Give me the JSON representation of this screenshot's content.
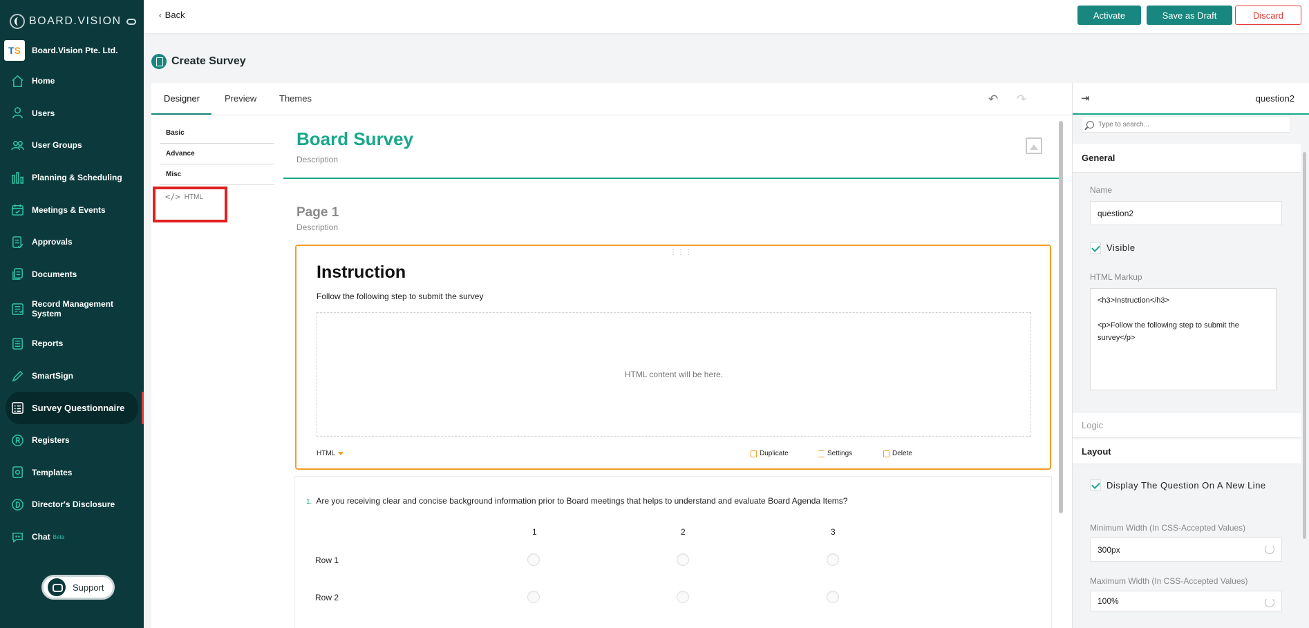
{
  "brand": {
    "name": "BOARD.VISION"
  },
  "org": {
    "name": "Board.Vision Pte. Ltd."
  },
  "nav": [
    {
      "label": "Home",
      "icon": "home-icon"
    },
    {
      "label": "Users",
      "icon": "user-icon"
    },
    {
      "label": "User Groups",
      "icon": "users-icon"
    },
    {
      "label": "Planning & Scheduling",
      "icon": "bar-chart-icon"
    },
    {
      "label": "Meetings & Events",
      "icon": "calendar-icon"
    },
    {
      "label": "Approvals",
      "icon": "approval-icon"
    },
    {
      "label": "Documents",
      "icon": "documents-icon"
    },
    {
      "label": "Record Management System",
      "icon": "records-icon"
    },
    {
      "label": "Reports",
      "icon": "reports-icon"
    },
    {
      "label": "SmartSign",
      "icon": "pen-icon"
    },
    {
      "label": "Survey Questionnaire",
      "icon": "survey-icon",
      "active": true
    },
    {
      "label": "Registers",
      "icon": "registers-icon"
    },
    {
      "label": "Templates",
      "icon": "templates-icon"
    },
    {
      "label": "Director's Disclosure",
      "icon": "disclosure-icon"
    },
    {
      "label": "Chat",
      "icon": "chat-icon",
      "badge": "Beta"
    }
  ],
  "support": {
    "label": "Support"
  },
  "topbar": {
    "back": "Back",
    "activate": "Activate",
    "save_draft": "Save as Draft",
    "discard": "Discard"
  },
  "page": {
    "title": "Create Survey"
  },
  "designer": {
    "tabs": [
      "Designer",
      "Preview",
      "Themes"
    ],
    "toolbox": {
      "categories": [
        "Basic",
        "Advance",
        "Misc"
      ],
      "item": "HTML"
    }
  },
  "survey": {
    "title": "Board Survey",
    "description": "Description",
    "page_name": "Page 1",
    "page_description": "Description",
    "html_question": {
      "heading": "Instruction",
      "paragraph": "Follow the following step to submit the survey",
      "placeholder": "HTML content will be here.",
      "type": "HTML",
      "actions": [
        "Duplicate",
        "Settings",
        "Delete"
      ]
    },
    "matrix_question": {
      "number": "1.",
      "text": "Are you receiving clear and concise background information prior to Board meetings that helps to understand and evaluate Board Agenda Items?",
      "columns": [
        "1",
        "2",
        "3"
      ],
      "rows": [
        "Row 1",
        "Row 2"
      ]
    }
  },
  "properties": {
    "question_name": "question2",
    "search_placeholder": "Type to search...",
    "general": "General",
    "name_label": "Name",
    "name_value": "question2",
    "visible_label": "Visible",
    "html_markup_label": "HTML Markup",
    "html_markup_value": "<h3>Instruction</h3>\n\n<p>Follow the following step to submit the survey</p>",
    "logic": "Logic",
    "layout": "Layout",
    "new_line_label": "Display The Question On A New Line",
    "min_width_label": "Minimum Width (In CSS-Accepted Values)",
    "min_width_value": "300px",
    "max_width_label": "Maximum Width (In CSS-Accepted Values)",
    "max_width_value": "100%"
  },
  "colors": {
    "sidebar": "#0c3a3c",
    "accent": "#17877f",
    "survey_title": "#19a78b",
    "selected_border": "#f39c24",
    "danger": "#e53935"
  }
}
